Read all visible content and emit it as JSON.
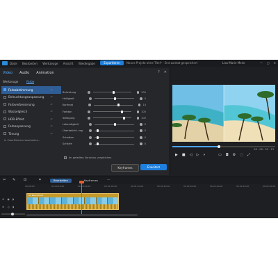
{
  "titlebar": {
    "menu": [
      "Datei",
      "Bearbeiten",
      "Werkzeuge",
      "Ansicht",
      "Wiedergabe"
    ],
    "export_label": "Exportieren",
    "project_title": "Neues Projekt ohne Titel* - Erst zuletzt gespeichert",
    "user": "Lisa-Marie Meier",
    "window_controls": [
      "—",
      "▢",
      "✕"
    ]
  },
  "dialog": {
    "tabs": [
      "Video",
      "Audio",
      "Animation"
    ],
    "active_tab": "Video",
    "help": "?",
    "close": "✕",
    "subtabs": [
      "Werkzeuge",
      "Farbe"
    ],
    "tools": [
      {
        "label": "Farbabstimmung",
        "checked": true
      },
      {
        "label": "Beleuchtungsanpassung",
        "checked": false
      },
      {
        "label": "Farbverbesserung",
        "checked": false
      },
      {
        "label": "Wackelgleich",
        "checked": false
      },
      {
        "label": "HDR-Effekt",
        "checked": false
      },
      {
        "label": "Farbanpassung",
        "checked": false
      },
      {
        "label": "Tönung",
        "checked": false
      }
    ],
    "colordirector_link": "In ColorDirector bearbeiten...",
    "adjustments": [
      {
        "label": "Belichtung",
        "value": "100",
        "level": 0.5
      },
      {
        "label": "Helligkeit",
        "value": "0",
        "level": 0.5
      },
      {
        "label": "Kontrast",
        "value": "14",
        "level": 0.6
      },
      {
        "label": "Farbton",
        "value": "100",
        "level": 0.7
      },
      {
        "label": "Sättigung",
        "value": "100",
        "level": 0.75
      },
      {
        "label": "Lebendigkeit",
        "value": "0",
        "level": 0.5
      },
      {
        "label": "Überbelicht. reg.",
        "value": "0",
        "level": 0.05
      },
      {
        "label": "Schatten",
        "value": "0",
        "level": 0.05
      },
      {
        "label": "Schärfe",
        "value": "0",
        "level": 0.05
      }
    ],
    "preview_option": "Im geteilten Vorschau vergleichen",
    "keyframes_label": "Keyframes",
    "reset_label": "Erweitert"
  },
  "preview": {
    "timecode": "00 : 00 : 03 . 13",
    "progress": 0.45
  },
  "timeline": {
    "tabs": [
      "Bearbeiten",
      "Keyframes"
    ],
    "ruler": [
      "00:00:00",
      "00:00:20:00",
      "00:00:40:00",
      "00:01:00:00",
      "00:01:20:00",
      "00:01:40:00",
      "00:02:00:00",
      "00:02:20:00",
      "00:02:40:00",
      "00:03:00:00"
    ],
    "clip_label": "01 Beachfront"
  }
}
